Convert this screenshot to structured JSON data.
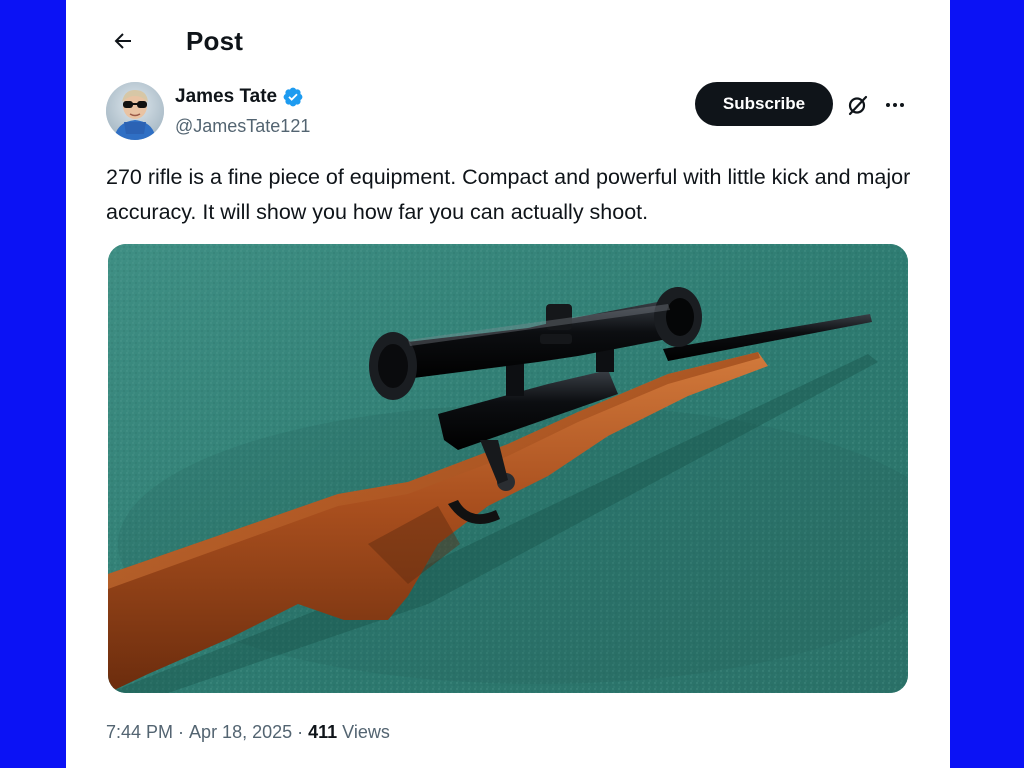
{
  "header": {
    "back_icon": "arrow-left-icon",
    "title": "Post"
  },
  "author": {
    "display_name": "James Tate",
    "verified_icon": "verified-badge-icon",
    "verified_color": "#1d9bf0",
    "handle": "@JamesTate121"
  },
  "actions": {
    "subscribe_label": "Subscribe",
    "grok_icon": "grok-icon",
    "more_icon": "more-horizontal-icon"
  },
  "post": {
    "text": "270 rifle is a fine piece of equipment. Compact and powerful with little kick and major accuracy. It will show you how far you can actually shoot.",
    "media": {
      "kind": "photo",
      "subject": "bolt-action rifle with scope on green felt"
    }
  },
  "meta": {
    "time": "7:44 PM",
    "separator": "·",
    "date": "Apr 18, 2025",
    "views_count": "411",
    "views_label": "Views"
  },
  "colors": {
    "frame_blue": "#0b12f5",
    "text_primary": "#0f1419",
    "text_secondary": "#536471",
    "button_dark": "#0f1419"
  }
}
